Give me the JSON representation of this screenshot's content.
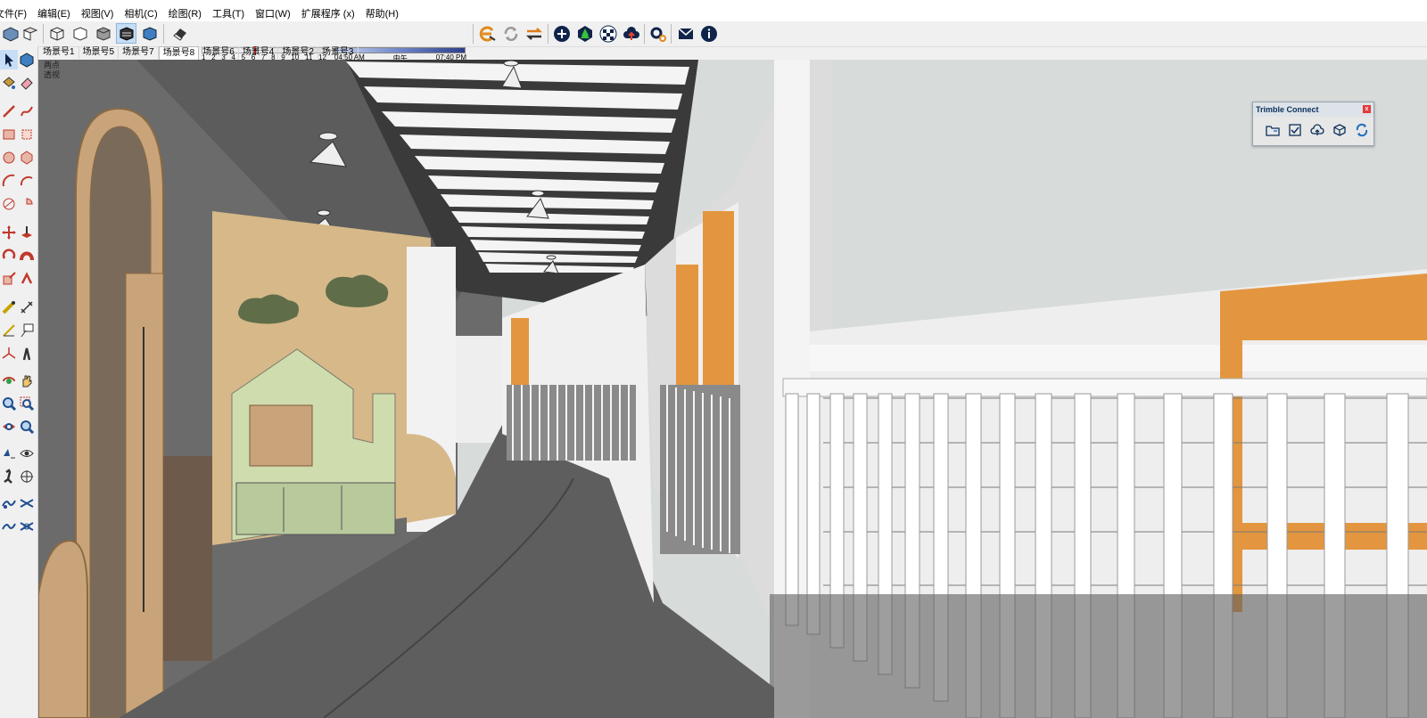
{
  "menu": {
    "items": [
      "文件(F)",
      "编辑(E)",
      "视图(V)",
      "相机(C)",
      "绘图(R)",
      "工具(T)",
      "窗口(W)",
      "扩展程序 (x)",
      "帮助(H)"
    ]
  },
  "toolbar": {
    "months": [
      "1",
      "2",
      "3",
      "4",
      "5",
      "6",
      "7",
      "8",
      "9",
      "10",
      "11",
      "12"
    ],
    "time_start": "04:50 AM",
    "time_mid": "中午",
    "time_end": "07:40 PM"
  },
  "scenes": {
    "tabs": [
      "场景号1",
      "场景号5",
      "场景号7",
      "场景号8",
      "场景号6",
      "场景号4",
      "场景号2",
      "场景号3"
    ],
    "active_index": 3
  },
  "viewport": {
    "label_line1": "两点",
    "label_line2": "透视"
  },
  "trimble": {
    "title": "Trimble Connect",
    "close": "x",
    "icons": [
      "open-folder-icon",
      "checklist-icon",
      "cloud-upload-icon",
      "publish-icon",
      "sync-icon"
    ]
  },
  "colors": {
    "accent": "#1f6fbf",
    "wood": "#c9a47a",
    "orange": "#e3963f",
    "floor": "#5e5e5e",
    "wall_dark": "#6b6b6b"
  }
}
